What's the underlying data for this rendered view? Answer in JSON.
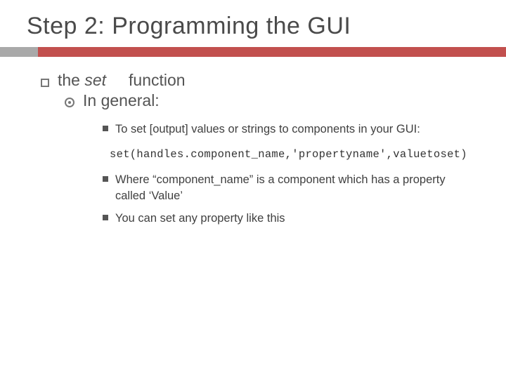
{
  "title": "Step 2: Programming the GUI",
  "lvl1": {
    "pre": "the ",
    "em": "set",
    "post": " function"
  },
  "lvl2": "In general:",
  "lvl3_a": "To set [output] values or strings to components in your GUI:",
  "code": "set(handles.component_name,'propertyname',valuetoset)",
  "lvl3_b": "Where “component_name” is a component which has a property called ‘Value’",
  "lvl3_c": "You can set any property like this"
}
